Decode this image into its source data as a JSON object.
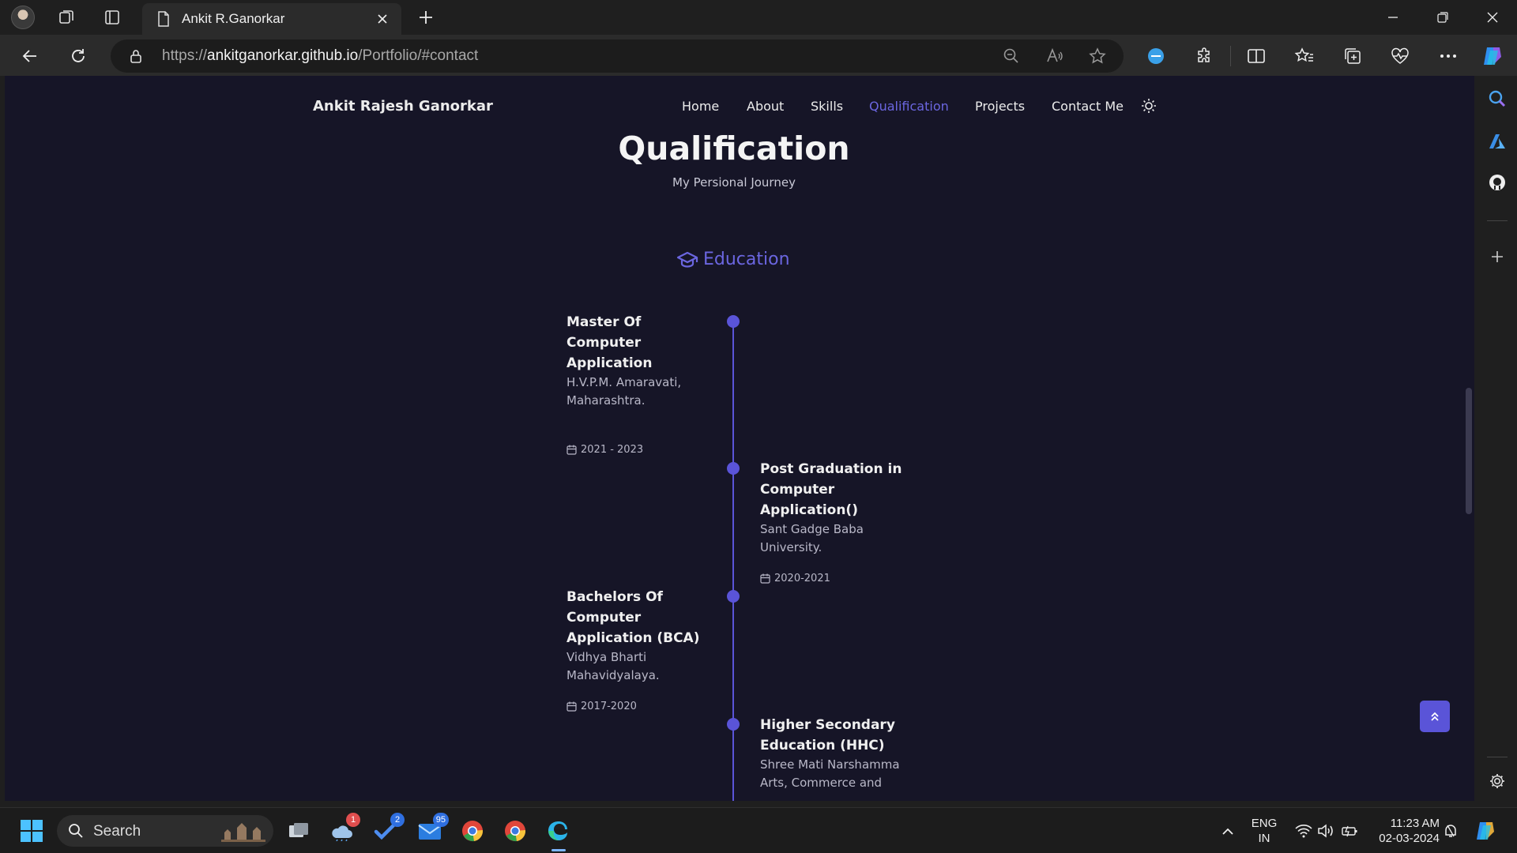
{
  "browser": {
    "tab_title": "Ankit R.Ganorkar",
    "url_scheme": "https://",
    "url_host": "ankitganorkar.github.io",
    "url_path": "/Portfolio/#contact"
  },
  "site": {
    "brand": "Ankit Rajesh Ganorkar",
    "nav": [
      "Home",
      "About",
      "Skills",
      "Qualification",
      "Projects",
      "Contact Me"
    ],
    "active_nav": "Qualification",
    "accent_color": "#5a54d8"
  },
  "section": {
    "title": "Qualification",
    "subtitle": "My Persional Journey",
    "tab": "Education"
  },
  "qualifications": [
    {
      "title": "Master Of Computer Application",
      "institution": "H.V.P.M. Amaravati, Maharashtra.",
      "date": "2021 - 2023",
      "side": "left"
    },
    {
      "title": "Post Graduation in Computer Application()",
      "institution": "Sant Gadge Baba University.",
      "date": "2020-2021",
      "side": "right"
    },
    {
      "title": "Bachelors Of Computer Application (BCA)",
      "institution": "Vidhya Bharti Mahavidyalaya.",
      "date": "2017-2020",
      "side": "left"
    },
    {
      "title": "Higher Secondary Education (HHC)",
      "institution": "Shree Mati Narshamma Arts, Commerce and",
      "date": "",
      "side": "right"
    }
  ],
  "taskbar": {
    "search_label": "Search",
    "badges": {
      "weather": "1",
      "todo": "2",
      "mail": "95"
    },
    "lang_top": "ENG",
    "lang_bottom": "IN",
    "time": "11:23 AM",
    "date": "02-03-2024"
  }
}
